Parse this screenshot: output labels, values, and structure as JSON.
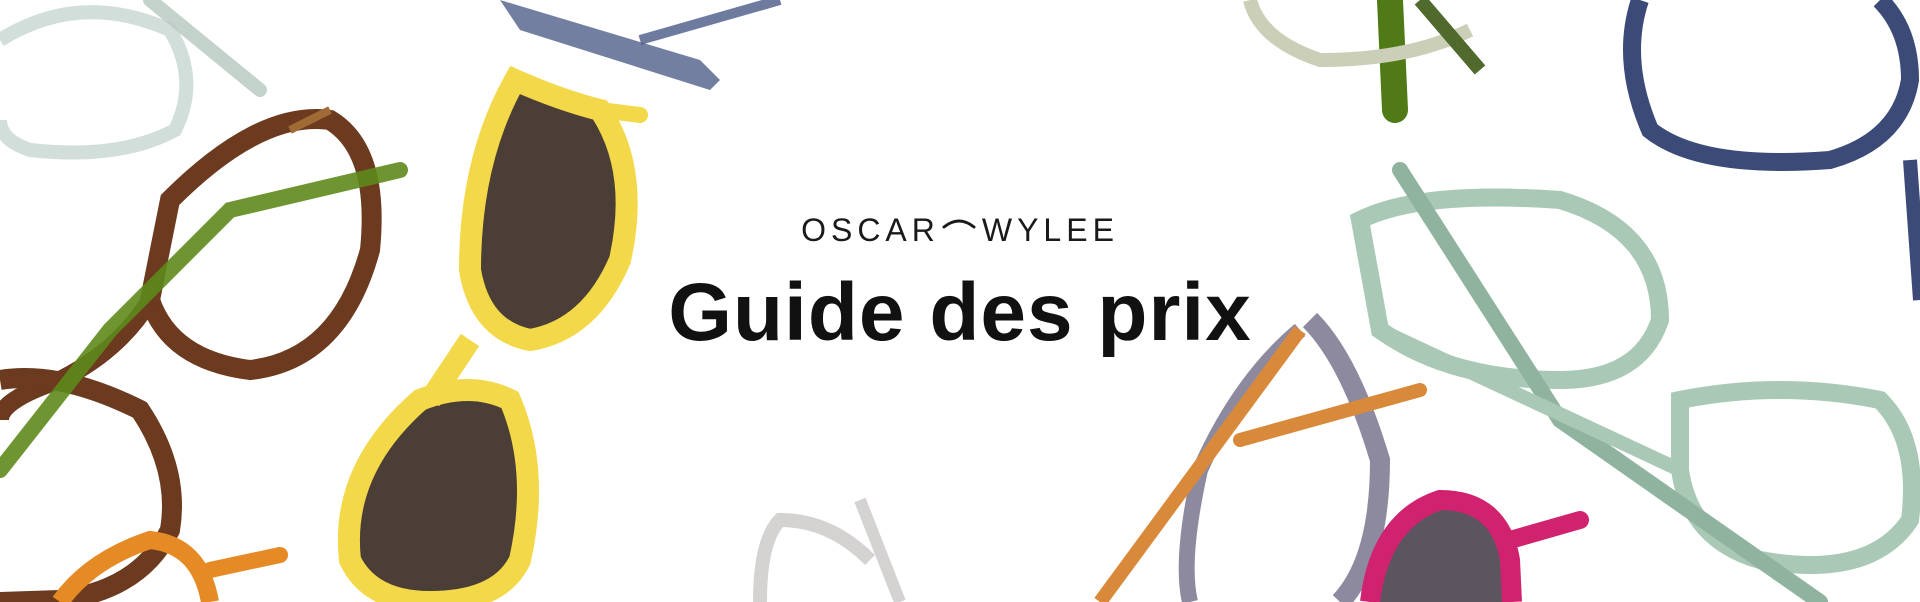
{
  "banner": {
    "brand_left": "OSCAR",
    "brand_right": "WYLEE",
    "title": "Guide des prix"
  },
  "icons": {
    "brand_mark": "brow-arc-icon"
  },
  "colors": {
    "background": "#ffffff",
    "text": "#111111",
    "frame_yellow": "#f3d84a",
    "frame_tortoise": "#6b3a1f",
    "frame_green_clear": "#a9c9b6",
    "frame_navy": "#4a5a86",
    "frame_orange": "#e58a25",
    "frame_grey": "#8d8aa0",
    "frame_magenta": "#d0226e",
    "frame_olive": "#5e8a1c",
    "lens_dark": "#4a3e36"
  }
}
